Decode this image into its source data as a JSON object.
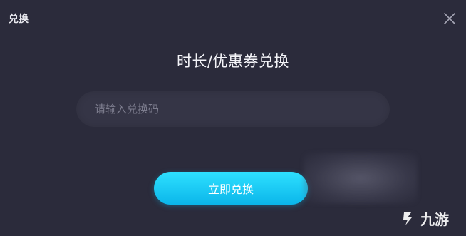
{
  "window": {
    "title": "兑换",
    "close_icon": "close-icon"
  },
  "main": {
    "heading": "时长/优惠券兑换",
    "code_input": {
      "placeholder": "请输入兑换码",
      "value": ""
    },
    "redeem_button_label": "立即兑换"
  },
  "watermark": {
    "logo_icon": "jiuyou-logo-icon",
    "text": "九游"
  },
  "colors": {
    "background": "#2b2b3b",
    "input_background": "#353546",
    "button_gradient_top": "#2ee0ff",
    "button_gradient_bottom": "#0bb6ea",
    "text_primary": "#f4f4f8",
    "placeholder": "#7d7d8e"
  }
}
